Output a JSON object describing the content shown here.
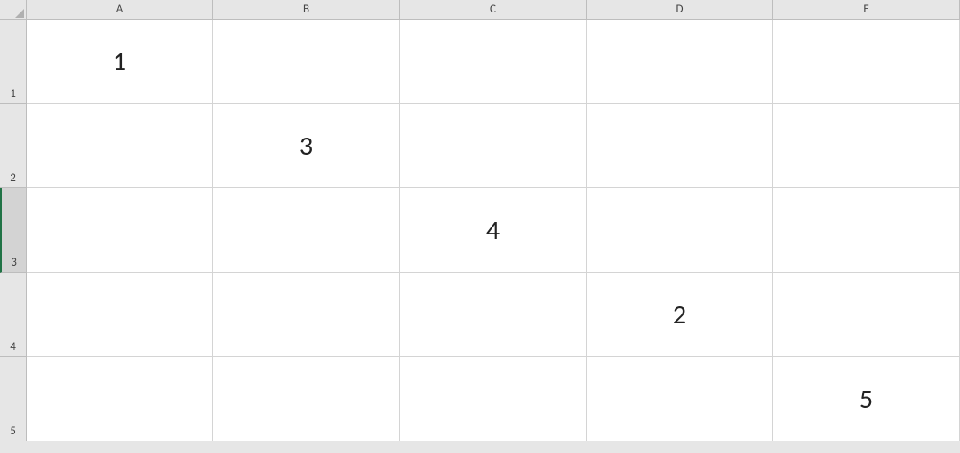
{
  "columns": [
    "A",
    "B",
    "C",
    "D",
    "E"
  ],
  "rows": [
    "1",
    "2",
    "3",
    "4",
    "5"
  ],
  "selectedRow": "3",
  "cells": {
    "A1": "1",
    "A2": "",
    "A3": "",
    "A4": "",
    "A5": "",
    "B1": "",
    "B2": "3",
    "B3": "",
    "B4": "",
    "B5": "",
    "C1": "",
    "C2": "",
    "C3": "4",
    "C4": "",
    "C5": "",
    "D1": "",
    "D2": "",
    "D3": "",
    "D4": "2",
    "D5": "",
    "E1": "",
    "E2": "",
    "E3": "",
    "E4": "",
    "E5": "5"
  }
}
